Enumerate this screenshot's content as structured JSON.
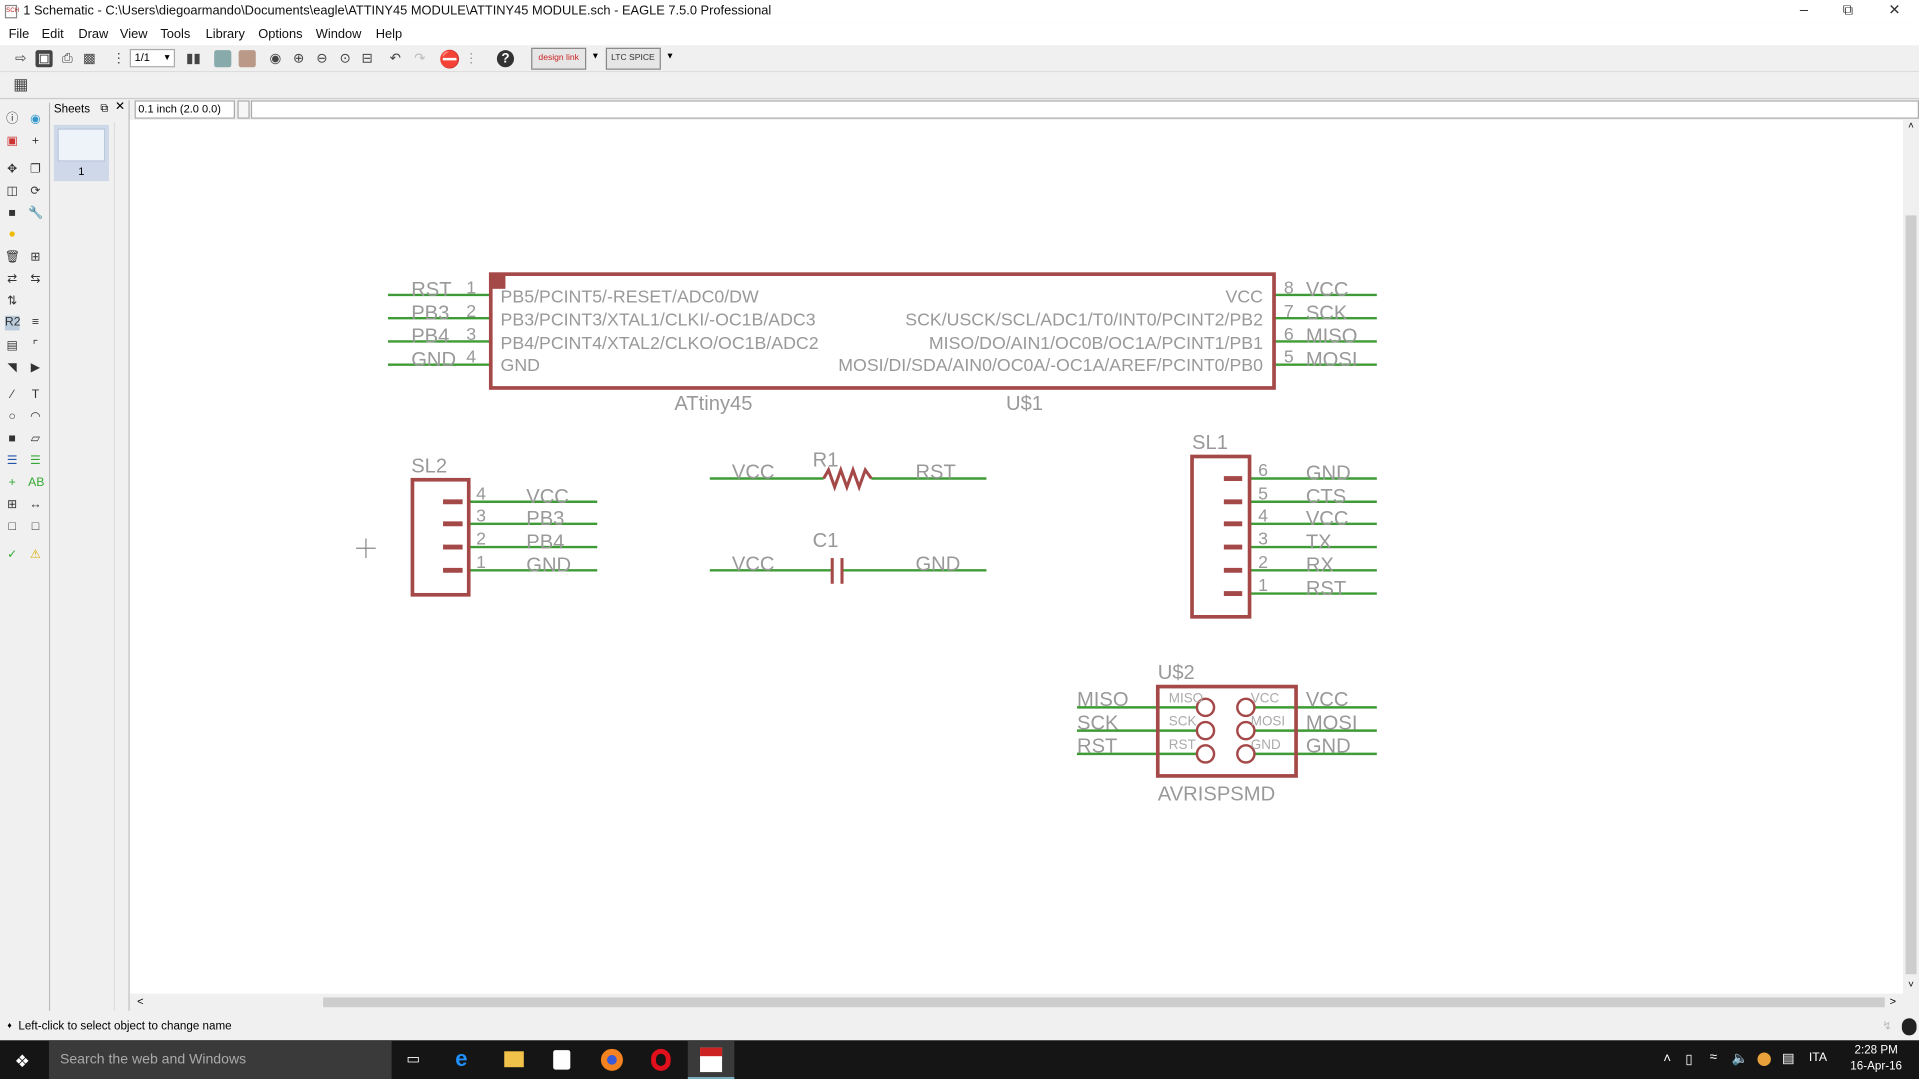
{
  "window": {
    "title": "1 Schematic - C:\\Users\\diegoarmando\\Documents\\eagle\\ATTINY45 MODULE\\ATTINY45 MODULE.sch - EAGLE 7.5.0 Professional",
    "icon_text": "SCH"
  },
  "menu": [
    "File",
    "Edit",
    "Draw",
    "View",
    "Tools",
    "Library",
    "Options",
    "Window",
    "Help"
  ],
  "toolbar": {
    "sheet_select": "1/1",
    "designlink": "design link",
    "ltspice": "LTC SPICE"
  },
  "sheets": {
    "title": "Sheets",
    "items": [
      {
        "label": "1"
      }
    ]
  },
  "coord": "0.1 inch (2.0 0.0)",
  "command_value": "",
  "schematic": {
    "u1": {
      "name": "U$1",
      "value": "ATtiny45",
      "left_pins": [
        {
          "num": "1",
          "net": "RST",
          "func": "PB5/PCINT5/-RESET/ADC0/DW"
        },
        {
          "num": "2",
          "net": "PB3",
          "func": "PB3/PCINT3/XTAL1/CLKI/-OC1B/ADC3"
        },
        {
          "num": "3",
          "net": "PB4",
          "func": "PB4/PCINT4/XTAL2/CLKO/OC1B/ADC2"
        },
        {
          "num": "4",
          "net": "GND",
          "func": "GND"
        }
      ],
      "right_pins": [
        {
          "num": "8",
          "net": "VCC",
          "func": "VCC"
        },
        {
          "num": "7",
          "net": "SCK",
          "func": "SCK/USCK/SCL/ADC1/T0/INT0/PCINT2/PB2"
        },
        {
          "num": "6",
          "net": "MISO",
          "func": "MISO/DO/AIN1/OC0B/OC1A/PCINT1/PB1"
        },
        {
          "num": "5",
          "net": "MOSI",
          "func": "MOSI/DI/SDA/AIN0/OC0A/-OC1A/AREF/PCINT0/PB0"
        }
      ]
    },
    "sl2": {
      "name": "SL2",
      "pins": [
        {
          "num": "4",
          "net": "VCC"
        },
        {
          "num": "3",
          "net": "PB3"
        },
        {
          "num": "2",
          "net": "PB4"
        },
        {
          "num": "1",
          "net": "GND"
        }
      ]
    },
    "r1": {
      "name": "R1",
      "left": "VCC",
      "right": "RST"
    },
    "c1": {
      "name": "C1",
      "left": "VCC",
      "right": "GND"
    },
    "sl1": {
      "name": "SL1",
      "pins": [
        {
          "num": "6",
          "net": "GND"
        },
        {
          "num": "5",
          "net": "CTS"
        },
        {
          "num": "4",
          "net": "VCC"
        },
        {
          "num": "3",
          "net": "TX"
        },
        {
          "num": "2",
          "net": "RX"
        },
        {
          "num": "1",
          "net": "RST"
        }
      ]
    },
    "u2": {
      "name": "U$2",
      "value": "AVRISPSMD",
      "left": [
        {
          "net": "MISO",
          "pin": "MISO"
        },
        {
          "net": "SCK",
          "pin": "SCK"
        },
        {
          "net": "RST",
          "pin": "RST"
        }
      ],
      "right": [
        {
          "net": "VCC",
          "pin": "VCC"
        },
        {
          "net": "MOSI",
          "pin": "MOSI"
        },
        {
          "net": "GND",
          "pin": "GND"
        }
      ]
    }
  },
  "status": "Left-click to select object to change name",
  "taskbar": {
    "search_placeholder": "Search the web and Windows",
    "lang": "ITA",
    "time": "2:28 PM",
    "date": "16-Apr-16"
  },
  "colors": {
    "wire": "#3e9b36",
    "symbol": "#a54848",
    "text": "#999999"
  }
}
